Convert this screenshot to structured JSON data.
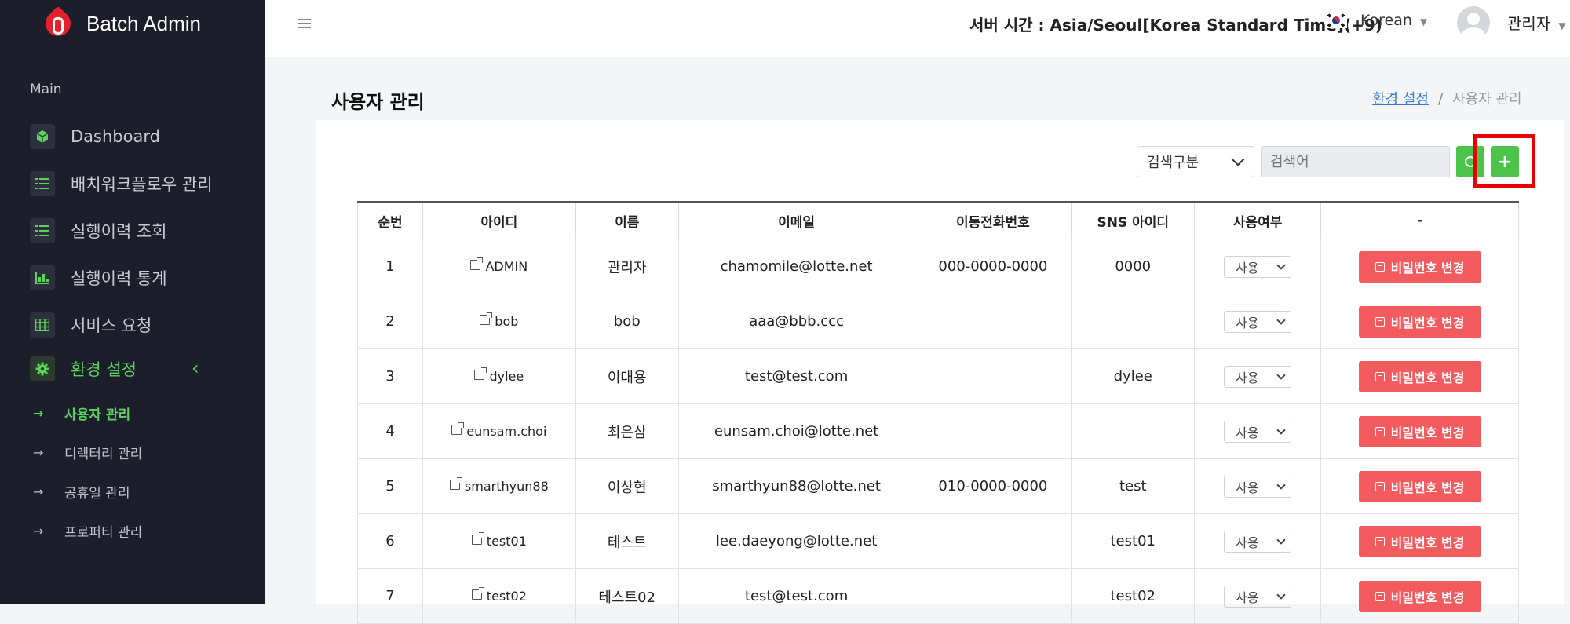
{
  "app": {
    "brand": "Batch Admin"
  },
  "sidebar": {
    "section_label": "Main",
    "items": [
      {
        "label": "Dashboard",
        "icon": "cube-icon"
      },
      {
        "label": "배치워크플로우 관리",
        "icon": "list-icon"
      },
      {
        "label": "실행이력 조회",
        "icon": "list-icon"
      },
      {
        "label": "실행이력 통계",
        "icon": "bar-chart-icon"
      },
      {
        "label": "서비스 요청",
        "icon": "grid-icon"
      },
      {
        "label": "환경 설정",
        "icon": "gear-icon",
        "active": true
      }
    ],
    "chevron": "‹",
    "subitems": [
      {
        "label": "사용자 관리",
        "active": true
      },
      {
        "label": "디렉터리 관리"
      },
      {
        "label": "공휴일 관리"
      },
      {
        "label": "프로퍼티 관리"
      }
    ]
  },
  "header": {
    "server_time": "서버 시간 : Asia/Seoul[Korea Standard Time](+9)",
    "language": "Korean",
    "user": "관리자"
  },
  "page": {
    "title": "사용자 관리",
    "breadcrumb": {
      "parent": "환경 설정",
      "separator": "/",
      "current": "사용자 관리"
    }
  },
  "search": {
    "category": "검색구분",
    "placeholder": "검색어",
    "add_label": "+"
  },
  "table": {
    "columns": [
      "순번",
      "아이디",
      "이름",
      "이메일",
      "이동전화번호",
      "SNS 아이디",
      "사용여부",
      "-"
    ],
    "use_value": "사용",
    "pw_button": "비밀번호 변경",
    "rows": [
      {
        "no": "1",
        "id": "ADMIN",
        "name": "관리자",
        "email": "chamomile@lotte.net",
        "phone": "000-0000-0000",
        "sns": "0000"
      },
      {
        "no": "2",
        "id": "bob",
        "name": "bob",
        "email": "aaa@bbb.ccc",
        "phone": "",
        "sns": ""
      },
      {
        "no": "3",
        "id": "dylee",
        "name": "이대용",
        "email": "test@test.com",
        "phone": "",
        "sns": "dylee"
      },
      {
        "no": "4",
        "id": "eunsam.choi",
        "name": "최은삼",
        "email": "eunsam.choi@lotte.net",
        "phone": "",
        "sns": ""
      },
      {
        "no": "5",
        "id": "smarthyun88",
        "name": "이상현",
        "email": "smarthyun88@lotte.net",
        "phone": "010-0000-0000",
        "sns": "test"
      },
      {
        "no": "6",
        "id": "test01",
        "name": "테스트",
        "email": "lee.daeyong@lotte.net",
        "phone": "",
        "sns": "test01"
      },
      {
        "no": "7",
        "id": "test02",
        "name": "테스트02",
        "email": "test@test.com",
        "phone": "",
        "sns": "test02"
      }
    ]
  },
  "colors": {
    "sidebar_bg": "#1d1e2b",
    "accent_green": "#4cc34a",
    "danger": "#f45b5f",
    "highlight": "#e60000"
  }
}
